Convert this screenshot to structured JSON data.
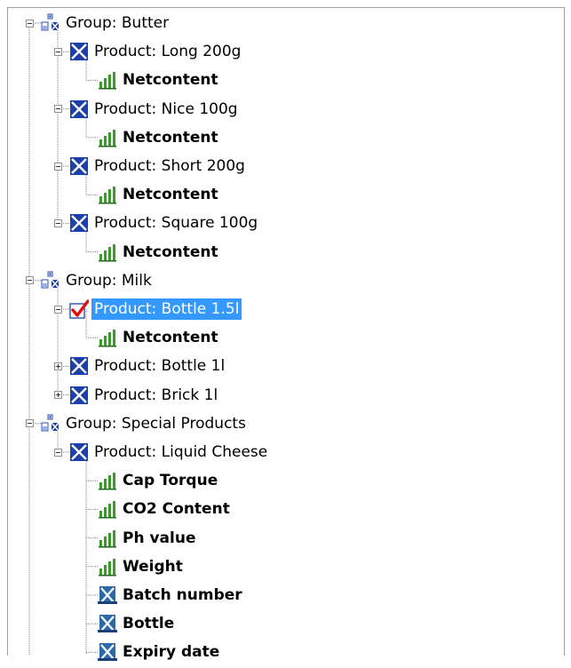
{
  "tree": [
    {
      "label": "Group: Butter",
      "icon": "group-icon",
      "level": 0,
      "expander": "minus",
      "bold": false
    },
    {
      "label": "Product: Long 200g",
      "icon": "product-x-icon",
      "level": 1,
      "expander": "minus",
      "bold": false
    },
    {
      "label": "Netcontent",
      "icon": "chart-icon",
      "level": 2,
      "expander": "none",
      "bold": true
    },
    {
      "label": "Product: Nice 100g",
      "icon": "product-x-icon",
      "level": 1,
      "expander": "minus",
      "bold": false
    },
    {
      "label": "Netcontent",
      "icon": "chart-icon",
      "level": 2,
      "expander": "none",
      "bold": true
    },
    {
      "label": "Product: Short 200g",
      "icon": "product-x-icon",
      "level": 1,
      "expander": "minus",
      "bold": false
    },
    {
      "label": "Netcontent",
      "icon": "chart-icon",
      "level": 2,
      "expander": "none",
      "bold": true
    },
    {
      "label": "Product: Square 100g",
      "icon": "product-x-icon",
      "level": 1,
      "expander": "minus",
      "bold": false
    },
    {
      "label": "Netcontent",
      "icon": "chart-icon",
      "level": 2,
      "expander": "none",
      "bold": true
    },
    {
      "label": "Group: Milk",
      "icon": "group-icon",
      "level": 0,
      "expander": "minus",
      "bold": false
    },
    {
      "label": "Product: Bottle 1.5l",
      "icon": "checkmark-icon",
      "level": 1,
      "expander": "minus",
      "bold": false,
      "selected": true
    },
    {
      "label": "Netcontent",
      "icon": "chart-icon",
      "level": 2,
      "expander": "none",
      "bold": true
    },
    {
      "label": "Product: Bottle 1l",
      "icon": "product-x-icon",
      "level": 1,
      "expander": "plus",
      "bold": false
    },
    {
      "label": "Product: Brick 1l",
      "icon": "product-x-icon",
      "level": 1,
      "expander": "plus",
      "bold": false
    },
    {
      "label": "Group: Special Products",
      "icon": "group-icon",
      "level": 0,
      "expander": "minus",
      "bold": false
    },
    {
      "label": "Product: Liquid Cheese",
      "icon": "product-x-icon",
      "level": 1,
      "expander": "minus",
      "bold": false
    },
    {
      "label": "Cap Torque",
      "icon": "chart-icon",
      "level": 2,
      "expander": "none",
      "bold": true
    },
    {
      "label": "CO2 Content",
      "icon": "chart-icon",
      "level": 2,
      "expander": "none",
      "bold": true
    },
    {
      "label": "Ph value",
      "icon": "chart-icon",
      "level": 2,
      "expander": "none",
      "bold": true
    },
    {
      "label": "Weight",
      "icon": "chart-icon",
      "level": 2,
      "expander": "none",
      "bold": true
    },
    {
      "label": "Batch number",
      "icon": "attribute-x-icon",
      "level": 2,
      "expander": "none",
      "bold": true
    },
    {
      "label": "Bottle",
      "icon": "attribute-x-icon",
      "level": 2,
      "expander": "none",
      "bold": true
    },
    {
      "label": "Expiry date",
      "icon": "attribute-x-icon",
      "level": 2,
      "expander": "none",
      "bold": true
    }
  ],
  "colors": {
    "selection": "#3399ff",
    "product_icon_blue": "#1c3fa8",
    "chart_green": "#3a9a2a",
    "check_red": "#e01010",
    "tree_line": "#808080"
  }
}
